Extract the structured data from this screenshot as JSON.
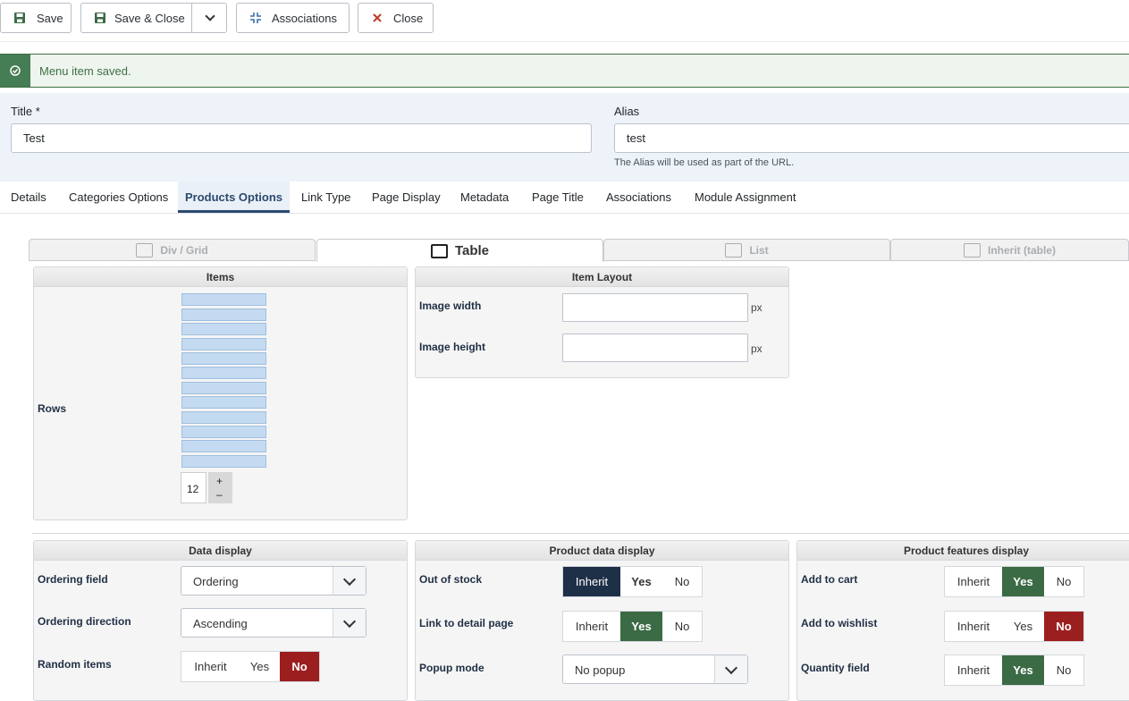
{
  "toolbar": {
    "save_label": "Save",
    "save_close_label": "Save & Close",
    "associations_label": "Associations",
    "close_label": "Close"
  },
  "alert": {
    "message": "Menu item saved.",
    "color": "#457d54"
  },
  "form": {
    "title_label": "Title *",
    "title_value": "Test",
    "alias_label": "Alias",
    "alias_value": "test",
    "alias_hint": "The Alias will be used as part of the URL."
  },
  "tabs": [
    "Details",
    "Categories Options",
    "Products Options",
    "Link Type",
    "Page Display",
    "Metadata",
    "Page Title",
    "Associations",
    "Module Assignment"
  ],
  "active_tab": "Products Options",
  "layout_tabs": [
    "Div / Grid",
    "Table",
    "List",
    "Inherit (table)"
  ],
  "active_layout_tab": "Table",
  "items_panel": {
    "title": "Items",
    "rows_label": "Rows",
    "rows_value": "12",
    "plus": "+",
    "minus": "–"
  },
  "item_layout": {
    "title": "Item Layout",
    "image_width_label": "Image width",
    "image_height_label": "Image height",
    "unit": "px"
  },
  "data_display": {
    "title": "Data display",
    "ordering_field_label": "Ordering field",
    "ordering_field_value": "Ordering",
    "ordering_direction_label": "Ordering direction",
    "ordering_direction_value": "Ascending",
    "random_items_label": "Random items"
  },
  "product_data_display": {
    "title": "Product data display",
    "out_of_stock_label": "Out of stock",
    "link_detail_label": "Link to detail page",
    "popup_mode_label": "Popup mode",
    "popup_mode_value": "No popup"
  },
  "product_features": {
    "title": "Product features display",
    "add_to_cart_label": "Add to cart",
    "add_to_wishlist_label": "Add to wishlist",
    "quantity_label": "Quantity field"
  },
  "options": {
    "inherit": "Inherit",
    "yes": "Yes",
    "no": "No"
  }
}
